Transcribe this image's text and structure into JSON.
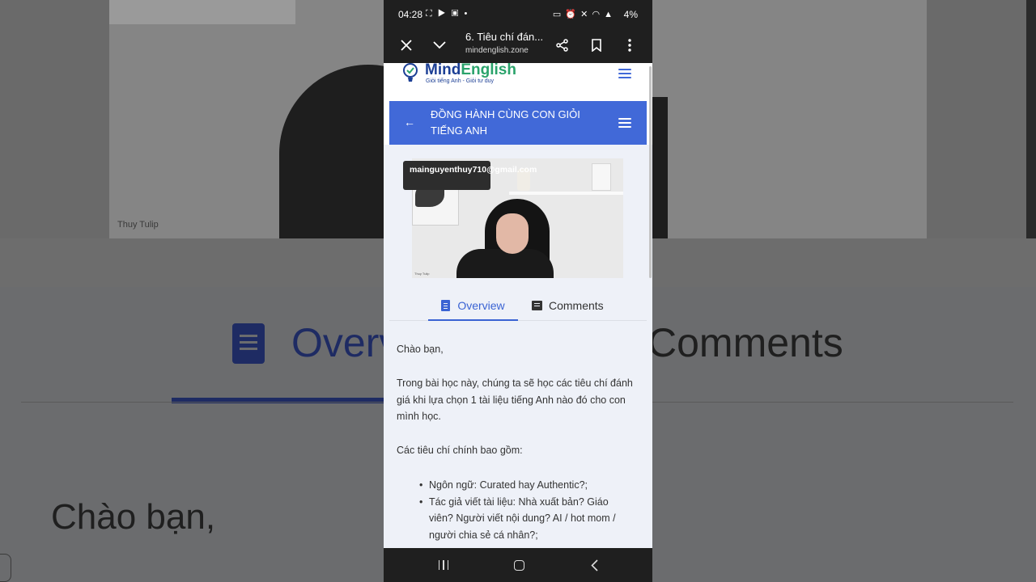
{
  "status_bar": {
    "time": "04:28",
    "left_icons": [
      "screenshot-icon",
      "youtube-icon",
      "gallery-icon",
      "dot-icon"
    ],
    "right_icons": [
      "bed-icon",
      "alarm-icon",
      "mute-icon",
      "wifi-icon",
      "volte-icon",
      "signal-icon"
    ],
    "battery": "4%"
  },
  "browser": {
    "page_title": "6. Tiêu chí đán...",
    "url": "mindenglish.zone"
  },
  "site": {
    "logo_part1": "Mind",
    "logo_part2": "English",
    "tagline": "Giỏi tiếng Anh - Giỏi tư duy",
    "brand_color": "#1c3f95",
    "accent_color": "#4169d8"
  },
  "course": {
    "title": "ĐỒNG HÀNH CÙNG CON GIỎI TIẾNG ANH"
  },
  "video": {
    "watermark": "mainguyenthuy710@gmail.com",
    "speaker_label": "Thuy Tulip"
  },
  "tabs": {
    "overview": "Overview",
    "comments": "Comments",
    "active": "Overview"
  },
  "article": {
    "greeting": "Chào bạn,",
    "intro": "Trong bài học này, chúng ta sẽ học các tiêu chí đánh giá khi lựa chọn 1 tài liệu tiếng Anh nào đó cho con mình học.",
    "criteria_heading": "Các tiêu chí chính bao gồm:",
    "bullets": [
      "Ngôn ngữ: Curated hay Authentic?;",
      "Tác giả viết tài liệu: Nhà xuất bản? Giáo viên? Người viết nội dung? AI / hot mom / người chia sẻ cá nhân?;"
    ]
  }
}
